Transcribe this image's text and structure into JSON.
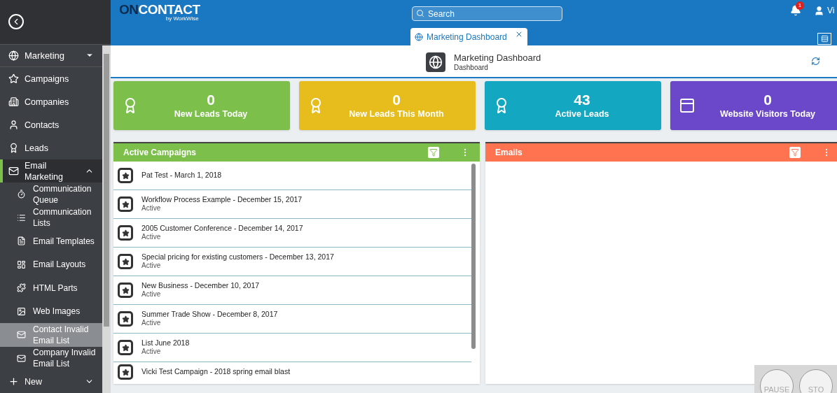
{
  "header": {
    "logo_bold": "ON",
    "logo_rest": "CONTACT",
    "logo_sub": "by WorkWise",
    "search": {
      "placeholder": "Search"
    },
    "notifications": "1",
    "user": "Vi"
  },
  "tabs": [
    {
      "label": "Marketing Dashboard",
      "selected": true
    }
  ],
  "page": {
    "title": "Marketing Dashboard",
    "subtitle": "Dashboard"
  },
  "sidebar": {
    "section": {
      "label": "Marketing",
      "expanded": false
    },
    "items": [
      {
        "label": "Campaigns",
        "selected": false
      },
      {
        "label": "Companies",
        "selected": false
      },
      {
        "label": "Contacts",
        "selected": false
      },
      {
        "label": "Leads",
        "selected": false
      },
      {
        "label": "Email Marketing",
        "selected": true,
        "expanded": true,
        "children": [
          {
            "label": "Communication Queue",
            "hovered": false
          },
          {
            "label": "Communication Lists",
            "hovered": false
          },
          {
            "label": "Email Templates",
            "hovered": false
          },
          {
            "label": "Email Layouts",
            "hovered": false
          },
          {
            "label": "HTML Parts",
            "hovered": false
          },
          {
            "label": "Web Images",
            "hovered": false
          },
          {
            "label": "Contact Invalid Email List",
            "hovered": true
          },
          {
            "label": "Company Invalid Email List",
            "hovered": false
          }
        ]
      },
      {
        "label": "New",
        "selected": false,
        "expanded": false
      }
    ]
  },
  "stats": [
    {
      "value": "0",
      "label": "New Leads Today",
      "color": "#7cc04b"
    },
    {
      "value": "0",
      "label": "New Leads This Month",
      "color": "#e7bd1d"
    },
    {
      "value": "43",
      "label": "Active Leads",
      "color": "#13a7c1"
    },
    {
      "value": "0",
      "label": "Website Visitors Today",
      "color": "#6a48c9"
    }
  ],
  "panels": [
    {
      "title": "Active Campaigns",
      "color": "#7cc04b",
      "rows": [
        {
          "title": "Pat Test - March 1, 2018"
        },
        {
          "title": "Workflow Process Example - December 15, 2017",
          "status": "Active"
        },
        {
          "title": "2005 Customer Conference - December 14, 2017",
          "status": "Active"
        },
        {
          "title": "Special pricing for existing customers - December 13, 2017",
          "status": "Active"
        },
        {
          "title": "New Business - December 10, 2017",
          "status": "Active"
        },
        {
          "title": "Summer Trade Show - December 8, 2017",
          "status": "Active"
        },
        {
          "title": "List June 2018",
          "status": "Active"
        },
        {
          "title": "Vicki Test Campaign - 2018 spring email blast"
        }
      ]
    },
    {
      "title": "Emails",
      "color": "#ff7350"
    }
  ],
  "recorder_controls": [
    "PAUSE",
    "STO"
  ]
}
